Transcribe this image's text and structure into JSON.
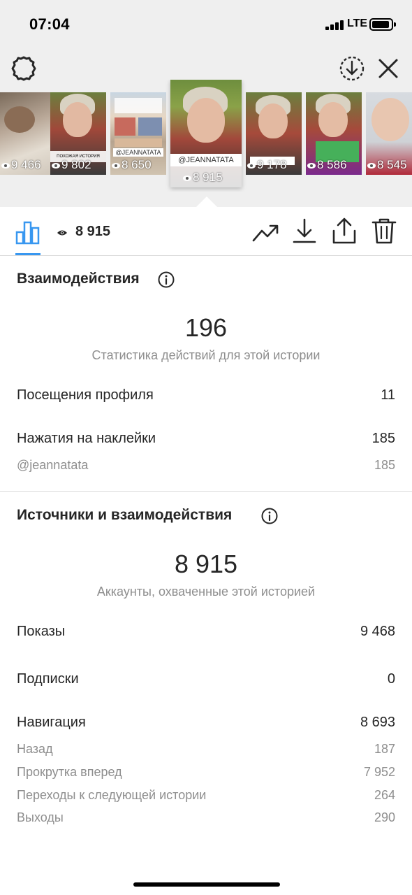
{
  "status_bar": {
    "time": "07:04",
    "network": "LTE"
  },
  "thumbnails": [
    {
      "views": "9 466"
    },
    {
      "views": "9 802",
      "caption": "ПОХОЖАЯ ИСТОРИЯ"
    },
    {
      "views": "8 650",
      "caption": "@JEANNATATA"
    },
    {
      "views": "8 915",
      "caption": "@JEANNATATA",
      "selected": true
    },
    {
      "views": "9 178"
    },
    {
      "views": "8 586"
    },
    {
      "views": "8 545"
    }
  ],
  "toolbar": {
    "views": "8 915"
  },
  "interactions": {
    "title": "Взаимодействия",
    "total": "196",
    "caption": "Статистика действий для этой истории",
    "rows": [
      {
        "label": "Посещения профиля",
        "value": "11"
      },
      {
        "label": "Нажатия на наклейки",
        "value": "185"
      }
    ],
    "sub_rows": [
      {
        "label": "@jeannatata",
        "value": "185"
      }
    ]
  },
  "discovery": {
    "title": "Источники и взаимодействия",
    "total": "8 915",
    "caption": "Аккаунты, охваченные этой историей",
    "rows": [
      {
        "label": "Показы",
        "value": "9 468"
      },
      {
        "label": "Подписки",
        "value": "0"
      },
      {
        "label": "Навигация",
        "value": "8 693"
      }
    ],
    "navigation": [
      {
        "label": "Назад",
        "value": "187"
      },
      {
        "label": "Прокрутка вперед",
        "value": "7 952"
      },
      {
        "label": "Переходы к следующей истории",
        "value": "264"
      },
      {
        "label": "Выходы",
        "value": "290"
      }
    ]
  },
  "colors": {
    "accent": "#3897f0",
    "text": "#262626",
    "muted": "#8e8e8e",
    "top_bg": "#efefef"
  }
}
